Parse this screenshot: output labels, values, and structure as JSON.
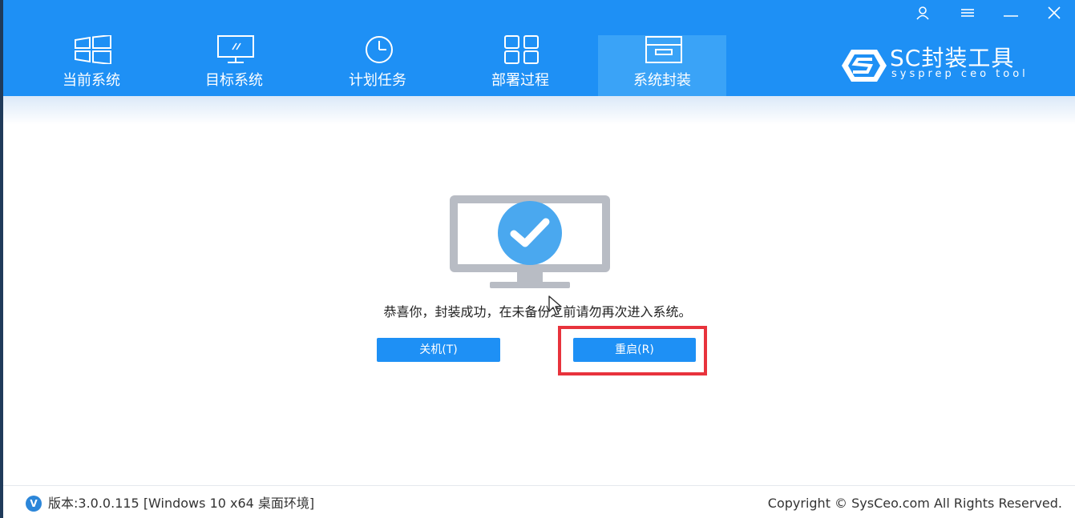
{
  "tabs": [
    {
      "label": "当前系统",
      "icon": "windows-grid-icon"
    },
    {
      "label": "目标系统",
      "icon": "monitor-icon"
    },
    {
      "label": "计划任务",
      "icon": "clock-icon"
    },
    {
      "label": "部署过程",
      "icon": "apps-grid-icon"
    },
    {
      "label": "系统封装",
      "icon": "archive-box-icon",
      "active": true
    }
  ],
  "window_controls": [
    "user-icon",
    "menu-icon",
    "minimize-icon",
    "close-icon"
  ],
  "brand": {
    "title": "SC封装工具",
    "subtitle": "sysprep ceo tool"
  },
  "main": {
    "message": "恭喜你，封装成功，在未备份之前请勿再次进入系统。",
    "shutdown_label": "关机(T)",
    "restart_label": "重启(R)"
  },
  "footer": {
    "version_badge": "V",
    "version": "版本:3.0.0.115 [Windows 10 x64 桌面环境]",
    "copyright": "Copyright © SysCeo.com All Rights Reserved."
  },
  "colors": {
    "header": "#1e90f5",
    "active_tab": "#3aa3f7",
    "button": "#1e90f5",
    "highlight": "#e8333c",
    "monitor": "#b8bcc4",
    "check_circle": "#4aa8ef"
  }
}
